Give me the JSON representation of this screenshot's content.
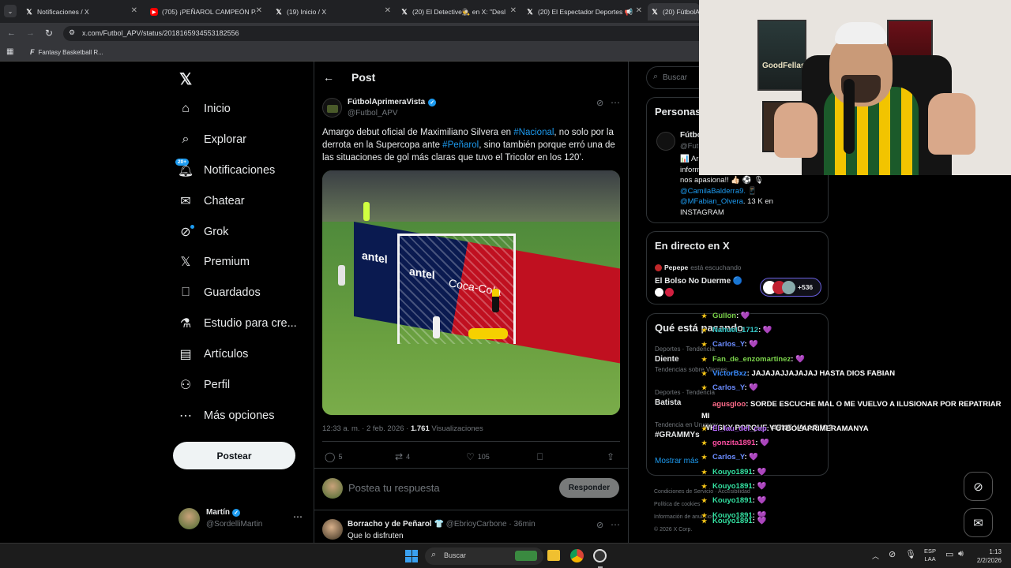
{
  "browser": {
    "tabs": [
      {
        "title": "Notificaciones / X",
        "icon": "x-logo"
      },
      {
        "title": "(705) ¡PEÑAROL CAMPEÓN P...",
        "icon": "youtube-logo"
      },
      {
        "title": "(19) Inicio / X",
        "icon": "x-logo"
      },
      {
        "title": "(20) El Detective🕵 en X: \"Desl",
        "icon": "x-logo"
      },
      {
        "title": "(20) El Espectador Deportes 📢",
        "icon": "x-logo"
      },
      {
        "title": "(20) FútbolA",
        "icon": "x-logo"
      }
    ],
    "url": "x.com/Futbol_APV/status/2018165934553182556",
    "bookmark": "Fantasy Basketball R..."
  },
  "nav": {
    "items": [
      {
        "label": "Inicio",
        "icon": "home-icon"
      },
      {
        "label": "Explorar",
        "icon": "search-icon"
      },
      {
        "label": "Notificaciones",
        "icon": "bell-icon",
        "badge": "20+"
      },
      {
        "label": "Chatear",
        "icon": "mail-icon"
      },
      {
        "label": "Grok",
        "icon": "grok-icon"
      },
      {
        "label": "Premium",
        "icon": "x-icon"
      },
      {
        "label": "Guardados",
        "icon": "bookmark-icon"
      },
      {
        "label": "Estudio para cre...",
        "icon": "flask-icon"
      },
      {
        "label": "Artículos",
        "icon": "article-icon"
      },
      {
        "label": "Perfil",
        "icon": "person-icon"
      },
      {
        "label": "Más opciones",
        "icon": "more-icon"
      }
    ],
    "post_label": "Postear",
    "user": {
      "name": "Martín",
      "handle": "@SordelliMartin"
    }
  },
  "post": {
    "header_title": "Post",
    "author": "FútbolAprimeraVista",
    "handle": "@Futbol_APV",
    "text_1": "Amargo debut oficial de Maximiliano Silvera en ",
    "tag_1": "#Nacional",
    "text_2": ", no solo por la derrota en la Supercopa ante ",
    "tag_2": "#Peñarol",
    "text_3": ", sino también porque erró una de las situaciones de gol más claras que tuvo el Tricolor en los 120’.",
    "time": "12:33 a. m. · 2 feb. 2026 · ",
    "views": "1.761",
    "views_label": "Visualizaciones",
    "replies": "5",
    "reposts": "4",
    "likes": "105",
    "reply_placeholder": "Postea tu respuesta",
    "reply_button": "Responder",
    "reply": {
      "author": "Borracho y de Peñarol 👕",
      "handle": "@EbrioyCarbone",
      "time": "· 36min",
      "text": "Que lo disfruten"
    }
  },
  "right": {
    "search_placeholder": "Buscar",
    "profile_card": {
      "title": "Personas",
      "name": "Fútbo",
      "handle": "@Futb",
      "bio_1": "📊 Ar",
      "bio_2": "inform",
      "bio_3": "nos apasiona!! 👍🏻 ⚽ 🎙",
      "bio_4": "@CamilaBalderra9. 📱",
      "bio_5": "@MFabian_Olvera",
      "bio_6": ". 13 K en",
      "bio_7": "INSTAGRAM"
    },
    "live": {
      "title": "En directo en X",
      "host": "Pepepe",
      "host_status": "está escuchando",
      "space": "El Bolso No Duerme 🔵",
      "count": "+536"
    },
    "trends": {
      "title": "Qué está pasando",
      "items": [
        {
          "meta": "Deportes · Tendencia",
          "name": "Diente",
          "sub": "Tendencias sobre Viernes"
        },
        {
          "meta": "Deportes · Tendencia",
          "name": "Batista"
        },
        {
          "meta": "Tendencia en Uruguay",
          "name": "#GRAMMYs"
        }
      ],
      "more": "Mostrar más"
    },
    "footer_1": "Condiciones de Servicio",
    "footer_1b": "Accesibilidad",
    "footer_2": "Política de cookies",
    "footer_3": "Información de anuncios",
    "footer_4": "© 2026 X Corp."
  },
  "chat": [
    {
      "user": "Gullon",
      "msg": ": 💜",
      "color": "#7bd34b"
    },
    {
      "user": "Nahuel_1712",
      "msg": ": 💜",
      "color": "#33c4c4"
    },
    {
      "user": "Carlos_Y",
      "msg": ": 💜",
      "color": "#6b8cff"
    },
    {
      "user": "Fan_de_enzomartinez",
      "msg": ": 💜",
      "color": "#7bd34b"
    },
    {
      "user": "VictorBxz",
      "msg": ": JAJAJAJJAJAJAJ HASTA DIOS FABIAN",
      "color": "#3a8cff"
    },
    {
      "user": "Carlos_Y",
      "msg": ": 💜",
      "color": "#6b8cff"
    },
    {
      "user": "agusgloo",
      "msg": ": SORDE ESCUCHE MAL O ME VUELVO A ILUSIONAR POR REPATRIAR MI",
      "msg2": "WHISKY PORQUE VIENE VALLEJO?",
      "color": "#ff6b8a"
    },
    {
      "user": "El_lau_del_cap",
      "msg": ": FUTBOLAPRIMERAMANYA",
      "color": "#b86bff"
    },
    {
      "user": "gonzita1891",
      "msg": ": 💜",
      "color": "#ff4fa3"
    },
    {
      "user": "Carlos_Y",
      "msg": ": 💜",
      "color": "#6b8cff"
    },
    {
      "user": "Kouyo1891",
      "msg": ": 💜",
      "color": "#33e0a0"
    },
    {
      "user": "Kouyo1891",
      "msg": ": 💜",
      "color": "#33e0a0"
    },
    {
      "user": "Kouyo1891",
      "msg": ": 💜",
      "color": "#33e0a0"
    },
    {
      "user": "Kouyo1891",
      "msg": ": 💜",
      "color": "#33e0a0"
    },
    {
      "user": "Kouyo1891",
      "msg": ": 💜",
      "color": "#33e0a0"
    }
  ],
  "taskbar": {
    "search_placeholder": "Buscar",
    "lang_1": "ESP",
    "lang_2": "LAA",
    "time": "1:13",
    "date": "2/2/2026"
  },
  "colors": {
    "accent": "#1d9bf0",
    "verified": "#1d9bf0"
  }
}
